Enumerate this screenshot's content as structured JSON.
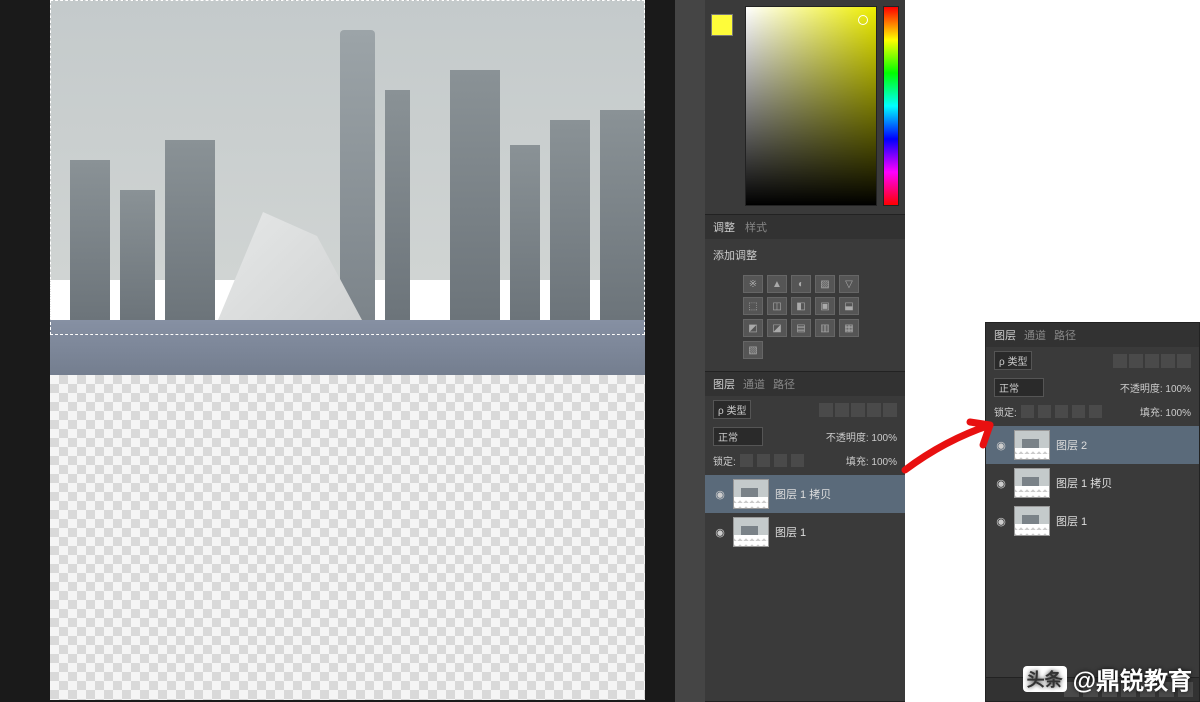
{
  "adjustments": {
    "tab1": "调整",
    "tab2": "样式",
    "add_label": "添加调整"
  },
  "layers1": {
    "tab1": "图层",
    "tab2": "通道",
    "tab3": "路径",
    "kind_label": "ρ 类型",
    "blend": "正常",
    "opacity_label": "不透明度:",
    "opacity_val": "100%",
    "lock_label": "锁定:",
    "fill_label": "填充:",
    "fill_val": "100%",
    "items": [
      {
        "name": "图层 1 拷贝",
        "selected": true
      },
      {
        "name": "图层 1",
        "selected": false
      }
    ]
  },
  "layers2": {
    "tab1": "图层",
    "tab2": "通道",
    "tab3": "路径",
    "kind_label": "ρ 类型",
    "blend": "正常",
    "opacity_label": "不透明度:",
    "opacity_val": "100%",
    "lock_label": "锁定:",
    "fill_label": "填充:",
    "fill_val": "100%",
    "items": [
      {
        "name": "图层 2",
        "selected": true
      },
      {
        "name": "图层 1 拷贝",
        "selected": false
      },
      {
        "name": "图层 1",
        "selected": false
      }
    ]
  },
  "watermark": {
    "badge": "头条",
    "text": "@鼎锐教育"
  }
}
